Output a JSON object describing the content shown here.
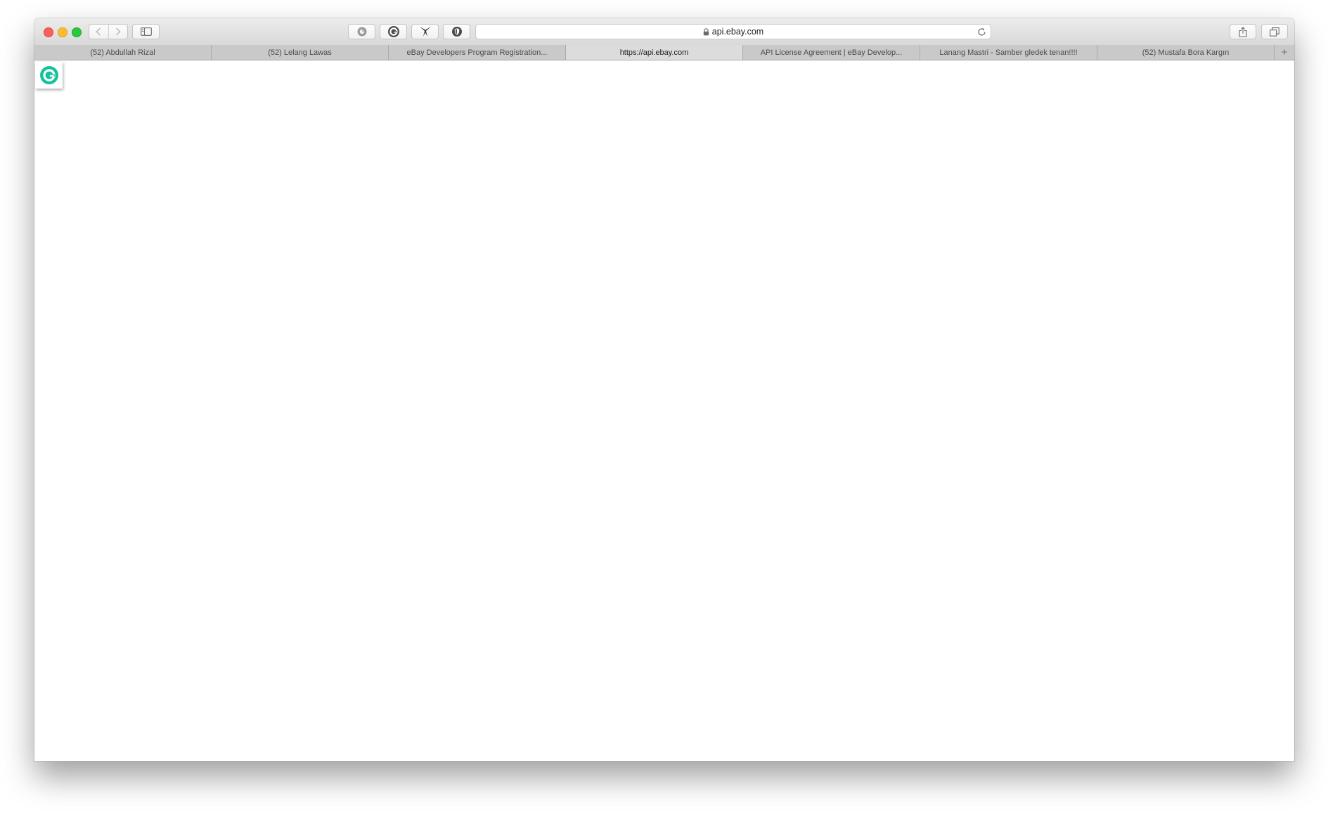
{
  "browser": {
    "address": "api.ebay.com",
    "tabs": [
      {
        "label": "(52) Abdullah Rizal",
        "active": false
      },
      {
        "label": "(52) Lelang Lawas",
        "active": false
      },
      {
        "label": "eBay Developers Program Registration...",
        "active": false
      },
      {
        "label": "https://api.ebay.com",
        "active": true
      },
      {
        "label": "API License Agreement | eBay Develop...",
        "active": false
      },
      {
        "label": "Lanang Mastri - Samber gledek tenan!!!!",
        "active": false
      },
      {
        "label": "(52) Mustafa Bora Kargın",
        "active": false
      }
    ],
    "new_tab_symbol": "+",
    "icons": {
      "back": "chevron-left-icon",
      "forward": "chevron-right-icon",
      "sidebar": "sidebar-icon",
      "lock": "lock-icon",
      "reload": "reload-icon",
      "share": "share-icon",
      "tabs": "tab-overview-icon",
      "extensions": [
        "puzzle-extension-icon",
        "grammarly-extension-icon",
        "star-extension-icon",
        "shield-extension-icon"
      ]
    },
    "colors": {
      "close": "#fc5f57",
      "minimize": "#fdbc2e",
      "maximize": "#29c83f",
      "grammarly": "#15c39a"
    }
  }
}
